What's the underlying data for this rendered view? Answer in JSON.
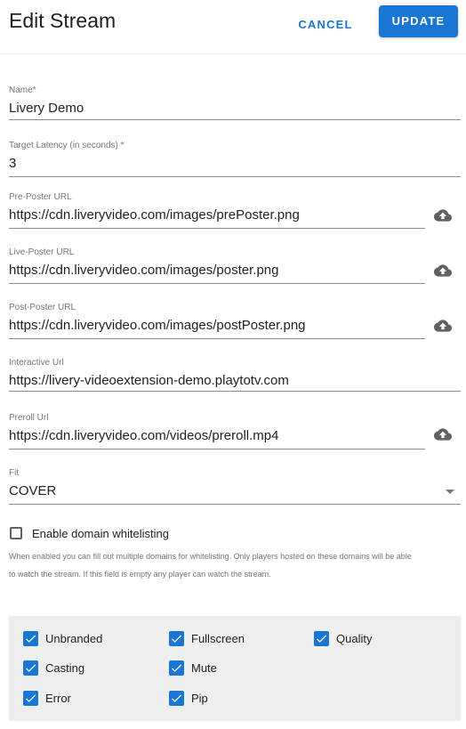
{
  "header": {
    "title": "Edit Stream",
    "cancel_label": "CANCEL",
    "update_label": "UPDATE"
  },
  "fields": {
    "name": {
      "label": "Name*",
      "value": "Livery Demo"
    },
    "latency": {
      "label": "Target Latency (in seconds) *",
      "value": "3"
    },
    "pre_poster": {
      "label": "Pre-Poster URL",
      "value": "https://cdn.liveryvideo.com/images/prePoster.png"
    },
    "live_poster": {
      "label": "Live-Poster URL",
      "value": "https://cdn.liveryvideo.com/images/poster.png"
    },
    "post_poster": {
      "label": "Post-Poster URL",
      "value": "https://cdn.liveryvideo.com/images/postPoster.png"
    },
    "interactive": {
      "label": "Interactive Url",
      "value": "https://livery-videoextension-demo.playtotv.com"
    },
    "preroll": {
      "label": "Preroll Url",
      "value": "https://cdn.liveryvideo.com/videos/preroll.mp4"
    },
    "fit": {
      "label": "Fit",
      "value": "COVER"
    }
  },
  "whitelist": {
    "label": "Enable domain whitelisting",
    "checked": false,
    "helper": "When enabled you can fill out multiple domains for whitelisting. Only players hosted on these domains will be able to watch the stream. If this field is empty any player can watch the stream."
  },
  "permissions": [
    {
      "label": "Unbranded",
      "checked": true
    },
    {
      "label": "Fullscreen",
      "checked": true
    },
    {
      "label": "Quality",
      "checked": true
    },
    {
      "label": "Casting",
      "checked": true
    },
    {
      "label": "Mute",
      "checked": true
    },
    {
      "label": "Error",
      "checked": true
    },
    {
      "label": "Pip",
      "checked": true
    }
  ],
  "colors": {
    "accent": "#1976d2",
    "panel": "#eeeeee",
    "icon": "#616161"
  },
  "icons": {
    "upload": "cloud-upload-icon",
    "checkbox": "check-icon",
    "dropdown": "arrow-drop-down-icon"
  }
}
